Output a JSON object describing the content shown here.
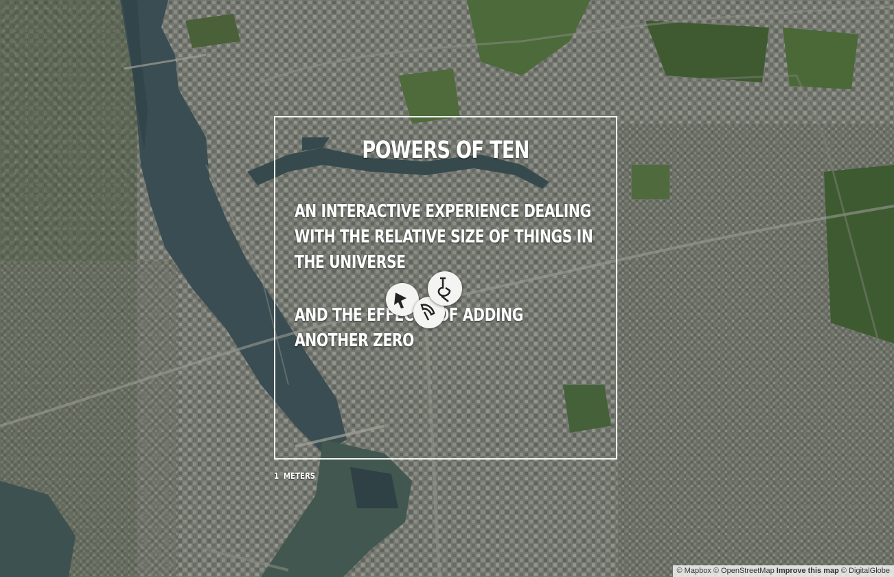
{
  "intro": {
    "title": "POWERS OF TEN",
    "paragraph1": "AN INTERACTIVE EXPERIENCE DEALING WITH THE RELATIVE SIZE OF THINGS IN THE UNIVERSE",
    "paragraph2": "AND THE EFFECTS OF ADDING ANOTHER ZERO"
  },
  "scale": {
    "value": "1",
    "unit": "METERS"
  },
  "attribution": {
    "mapbox": "© Mapbox",
    "osm": "© OpenStreetMap",
    "improve": "Improve this map",
    "digitalglobe": "© DigitalGlobe"
  },
  "colors": {
    "water": "#3a4d52",
    "urban": "#6f746c",
    "park": "#4a6438",
    "frame": "#ffffff"
  },
  "icons": {
    "markers": [
      "cursor-glyph-icon",
      "pointer-glyph-icon",
      "hand-glyph-icon"
    ]
  }
}
